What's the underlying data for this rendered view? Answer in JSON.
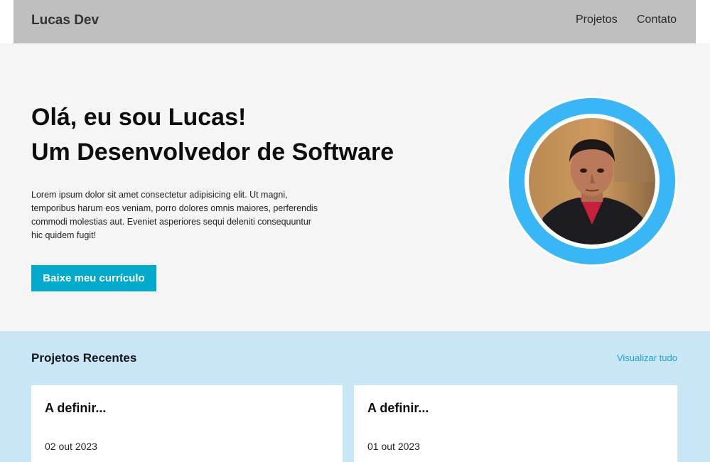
{
  "navbar": {
    "brand": "Lucas Dev",
    "links": [
      {
        "label": "Projetos"
      },
      {
        "label": "Contato"
      }
    ]
  },
  "hero": {
    "title_line1": "Olá, eu sou Lucas!",
    "title_line2": "Um Desenvolvedor de Software",
    "text": "Lorem ipsum dolor sit amet consectetur adipisicing elit. Ut magni, temporibus harum eos veniam, porro dolores omnis maiores, perferendis commodi molestias aut. Eveniet asperiores sequi deleniti consequuntur hic quidem fugit!",
    "button_label": "Baixe meu currículo",
    "avatar_icon": "profile-photo"
  },
  "projects": {
    "title": "Projetos Recentes",
    "view_all": "Visualizar tudo",
    "cards": [
      {
        "title": "A definir...",
        "date": "02 out 2023"
      },
      {
        "title": "A definir...",
        "date": "01 out 2023"
      }
    ]
  },
  "colors": {
    "navbar_bg": "#bfbfbf",
    "hero_bg": "#f5f5f5",
    "accent": "#01a9cb",
    "ring": "#38b6f5",
    "projects_bg": "#c8e6f5"
  }
}
